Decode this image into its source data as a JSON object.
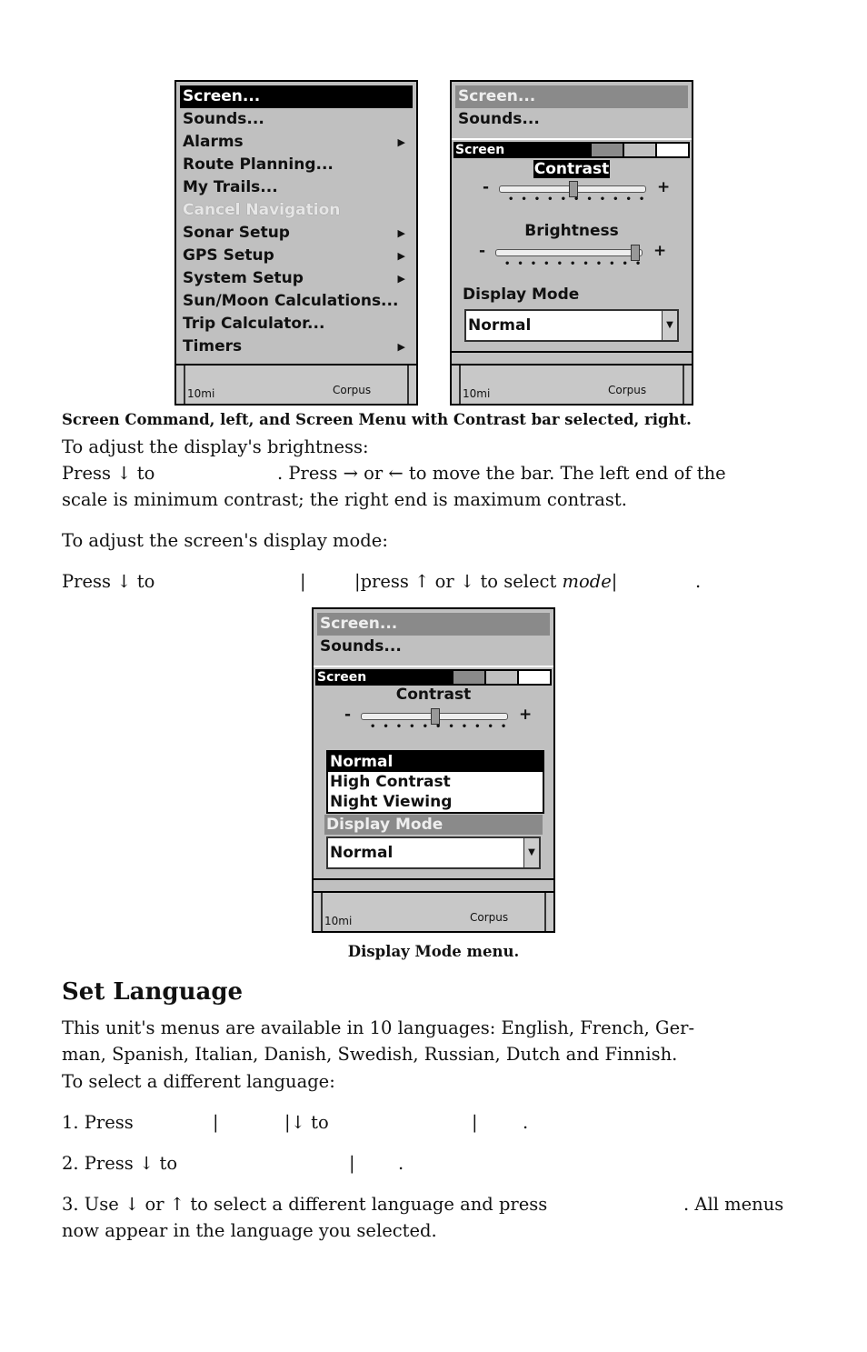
{
  "screens": {
    "left": {
      "items": [
        "Screen...",
        "Sounds...",
        "Alarms",
        "Route Planning...",
        "My Trails...",
        "Cancel Navigation",
        "Sonar Setup",
        "GPS Setup",
        "System Setup",
        "Sun/Moon Calculations...",
        "Trip Calculator...",
        "Timers"
      ],
      "map_scale": "10mi",
      "map_label": "Corpus"
    },
    "right": {
      "items": [
        "Screen...",
        "Sounds..."
      ],
      "panel_title": "Screen",
      "contrast_label": "Contrast",
      "brightness_label": "Brightness",
      "display_mode_label": "Display Mode",
      "display_mode_value": "Normal",
      "contrast_level": 0.45,
      "brightness_level": 0.95,
      "map_scale": "10mi",
      "map_label": "Corpus"
    },
    "bottom": {
      "items": [
        "Screen...",
        "Sounds..."
      ],
      "panel_title": "Screen",
      "contrast_label": "Contrast",
      "options": [
        "Normal",
        "High Contrast",
        "Night Viewing"
      ],
      "display_mode_label": "Display Mode",
      "display_mode_value": "Normal",
      "map_scale": "10mi",
      "map_label": "Corpus"
    }
  },
  "caption1": "Screen Command, left, and Screen Menu with Contrast bar selected, right.",
  "p1": "To adjust the display's brightness:",
  "p2a": "Press ↓ to",
  "p2b": ". Press → or ← to move the bar. The left end of the",
  "p3": "scale is minimum contrast; the right end is maximum contrast.",
  "p4": "To adjust the screen's display mode:",
  "p5a": "Press ↓ to",
  "p5b": "|",
  "p5c": "|press ↑ or ↓ to select ",
  "p5d": "mode",
  "p5e": "|",
  "p5f": ".",
  "caption2": "Display Mode menu.",
  "heading": "Set Language",
  "l1": "This unit's menus are available in 10 languages: English, French, Ger-",
  "l2": "man, Spanish, Italian, Danish, Swedish, Russian, Dutch and Finnish.",
  "l3": "To select a different language:",
  "s1a": "1. Press",
  "s1b": "|",
  "s1c": "|↓ to",
  "s1d": "|",
  "s1e": ".",
  "s2a": "2. Press ↓ to",
  "s2b": "|",
  "s2c": ".",
  "s3a": "3. Use ↓ or ↑ to select a different language and press",
  "s3b": ". All menus",
  "s3c": "now appear in the language you selected."
}
